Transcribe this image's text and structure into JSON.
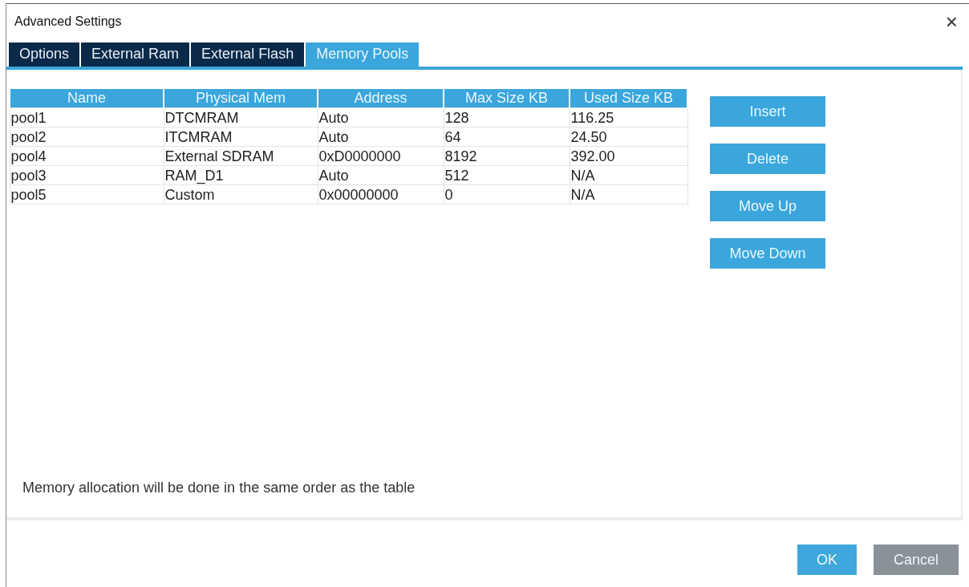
{
  "window": {
    "title": "Advanced Settings",
    "close": "×"
  },
  "tabs": [
    {
      "label": "Options",
      "selected": false
    },
    {
      "label": "External Ram",
      "selected": false
    },
    {
      "label": "External Flash",
      "selected": false
    },
    {
      "label": "Memory Pools",
      "selected": true
    }
  ],
  "table": {
    "columns": [
      "Name",
      "Physical Mem",
      "Address",
      "Max Size KB",
      "Used Size KB"
    ],
    "rows": [
      [
        "pool1",
        "DTCMRAM",
        "Auto",
        "128",
        "116.25"
      ],
      [
        "pool2",
        "ITCMRAM",
        "Auto",
        "64",
        "24.50"
      ],
      [
        "pool4",
        "External SDRAM",
        "0xD0000000",
        "8192",
        "392.00"
      ],
      [
        "pool3",
        "RAM_D1",
        "Auto",
        "512",
        "N/A"
      ],
      [
        "pool5",
        "Custom",
        "0x00000000",
        "0",
        "N/A"
      ]
    ]
  },
  "side_buttons": [
    "Insert",
    "Delete",
    "Move Up",
    "Move Down"
  ],
  "note": "Memory allocation will be done in the same order as the table",
  "buttons": [
    {
      "label": "OK",
      "kind": "primary"
    },
    {
      "label": "Cancel",
      "kind": "secondary"
    }
  ]
}
